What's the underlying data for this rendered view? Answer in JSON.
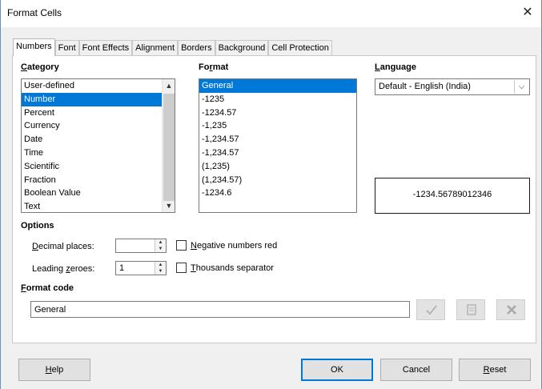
{
  "window": {
    "title": "Format Cells",
    "close_glyph": "✕"
  },
  "tabs": [
    "Numbers",
    "Font",
    "Font Effects",
    "Alignment",
    "Borders",
    "Background",
    "Cell Protection"
  ],
  "category": {
    "label": "Category",
    "items": [
      "User-defined",
      "Number",
      "Percent",
      "Currency",
      "Date",
      "Time",
      "Scientific",
      "Fraction",
      "Boolean Value",
      "Text"
    ],
    "selected": "Number"
  },
  "format": {
    "label": "Format",
    "items": [
      "General",
      "-1235",
      "-1234.57",
      "-1,235",
      "-1,234.57",
      "-1,234.57",
      "(1,235)",
      "(1,234.57)",
      "-1234.6"
    ],
    "selected": "General"
  },
  "language": {
    "label": "Language",
    "value": "Default - English (India)"
  },
  "preview": {
    "text": "-1234.56789012346"
  },
  "options": {
    "label": "Options",
    "decimal_places": {
      "label": "Decimal places:",
      "value": ""
    },
    "leading_zeroes": {
      "label": "Leading zeroes:",
      "value": "1"
    },
    "negative_red": {
      "label": "Negative numbers red",
      "checked": false
    },
    "thousands_sep": {
      "label": "Thousands separator",
      "checked": false
    }
  },
  "format_code": {
    "label": "Format code",
    "value": "General"
  },
  "icons": {
    "add": "checkmark-icon",
    "edit_comment": "comment-icon",
    "delete": "delete-icon"
  },
  "buttons": {
    "help": "Help",
    "ok": "OK",
    "cancel": "Cancel",
    "reset": "Reset"
  },
  "colors": {
    "selection": "#0078d7",
    "panel": "#ffffff",
    "dialog_bg": "#f0f0f0"
  }
}
